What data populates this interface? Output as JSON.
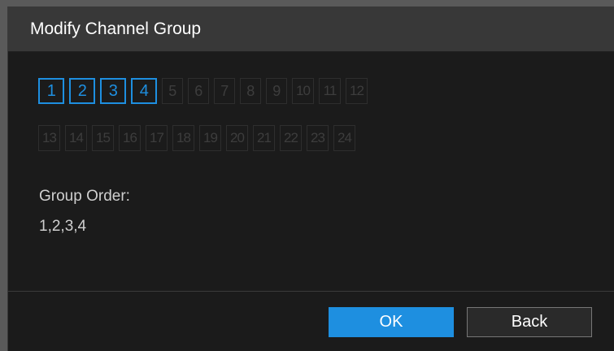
{
  "dialog": {
    "title": "Modify Channel Group"
  },
  "channels": {
    "row1": [
      {
        "label": "1",
        "selected": true
      },
      {
        "label": "2",
        "selected": true
      },
      {
        "label": "3",
        "selected": true
      },
      {
        "label": "4",
        "selected": true
      },
      {
        "label": "5",
        "selected": false
      },
      {
        "label": "6",
        "selected": false
      },
      {
        "label": "7",
        "selected": false
      },
      {
        "label": "8",
        "selected": false
      },
      {
        "label": "9",
        "selected": false
      },
      {
        "label": "10",
        "selected": false
      },
      {
        "label": "11",
        "selected": false
      },
      {
        "label": "12",
        "selected": false
      }
    ],
    "row2": [
      {
        "label": "13",
        "selected": false
      },
      {
        "label": "14",
        "selected": false
      },
      {
        "label": "15",
        "selected": false
      },
      {
        "label": "16",
        "selected": false
      },
      {
        "label": "17",
        "selected": false
      },
      {
        "label": "18",
        "selected": false
      },
      {
        "label": "19",
        "selected": false
      },
      {
        "label": "20",
        "selected": false
      },
      {
        "label": "21",
        "selected": false
      },
      {
        "label": "22",
        "selected": false
      },
      {
        "label": "23",
        "selected": false
      },
      {
        "label": "24",
        "selected": false
      }
    ]
  },
  "group_order": {
    "label": "Group Order:",
    "value": "1,2,3,4"
  },
  "buttons": {
    "ok_label": "OK",
    "back_label": "Back"
  },
  "colors": {
    "accent": "#1e8fe0",
    "background": "#1b1b1b",
    "title_bar": "#383838"
  }
}
